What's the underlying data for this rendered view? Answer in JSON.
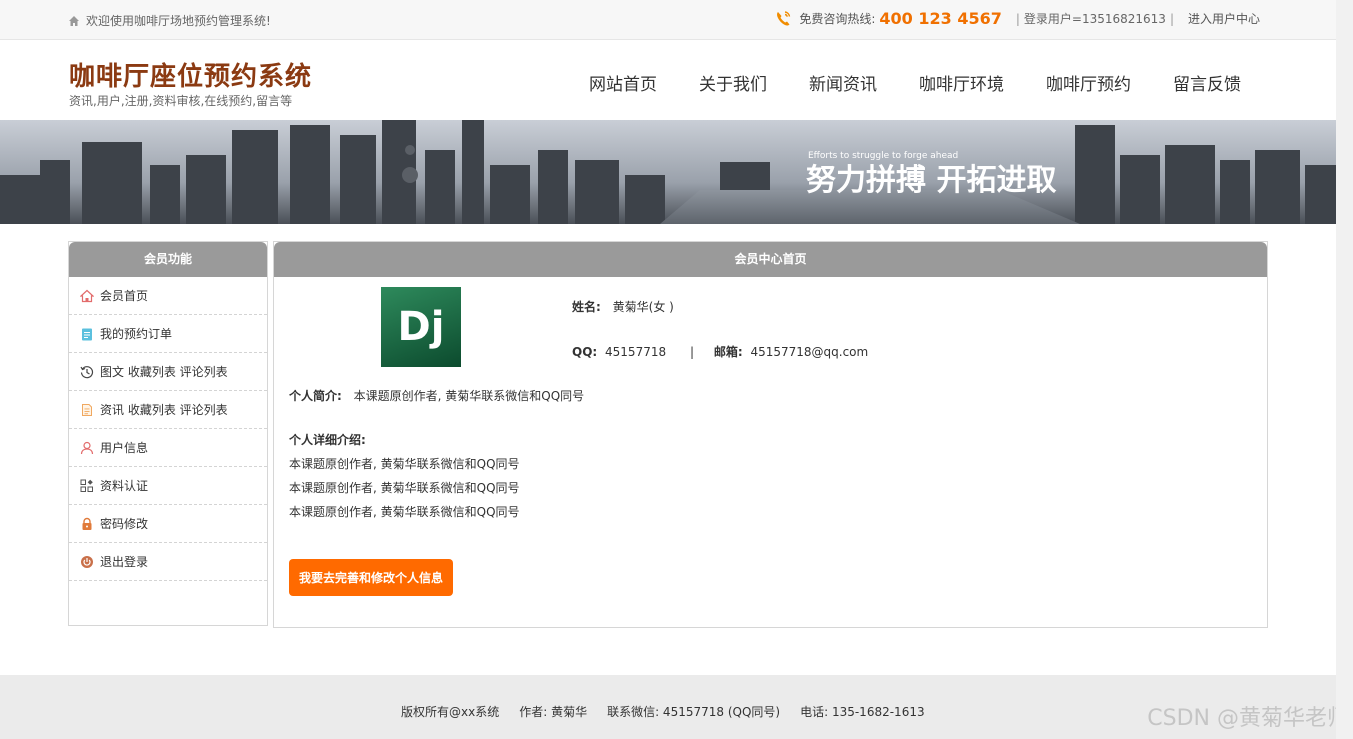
{
  "topbar": {
    "welcome": "欢迎使用咖啡厅场地预约管理系统!",
    "hotline_label": "免费咨询热线:",
    "hotline_number": "400 123 4567",
    "login_user": "登录用户=13516821613",
    "user_center_link": "进入用户中心"
  },
  "header": {
    "title": "咖啡厅座位预约系统",
    "subtitle": "资讯,用户,注册,资料审核,在线预约,留言等"
  },
  "nav": [
    "网站首页",
    "关于我们",
    "新闻资讯",
    "咖啡厅环境",
    "咖啡厅预约",
    "留言反馈"
  ],
  "banner": {
    "small_text": "Efforts to struggle to forge ahead",
    "slogan": "努力拼搏 开拓进取"
  },
  "sidebar": {
    "title": "会员功能",
    "items": [
      {
        "label": "会员首页",
        "icon": "home-icon"
      },
      {
        "label": "我的预约订单",
        "icon": "clipboard-icon"
      },
      {
        "label": "图文 收藏列表 评论列表",
        "icon": "history-icon"
      },
      {
        "label": "资讯 收藏列表 评论列表",
        "icon": "document-icon"
      },
      {
        "label": "用户信息",
        "icon": "user-icon"
      },
      {
        "label": "资料认证",
        "icon": "grid-icon"
      },
      {
        "label": "密码修改",
        "icon": "lock-icon"
      },
      {
        "label": "退出登录",
        "icon": "power-icon"
      }
    ]
  },
  "main": {
    "title": "会员中心首页",
    "avatar_text": "Dj",
    "name_label": "姓名:",
    "name_value": "黄菊华(女 )",
    "qq_label": "QQ:",
    "qq_value": "45157718",
    "divider": "|",
    "email_label": "邮箱:",
    "email_value": "45157718@qq.com",
    "intro_label": "个人简介:",
    "intro_value": "本课题原创作者, 黄菊华联系微信和QQ同号",
    "detail_label": "个人详细介绍:",
    "detail_lines": [
      "本课题原创作者, 黄菊华联系微信和QQ同号",
      "本课题原创作者, 黄菊华联系微信和QQ同号",
      "本课题原创作者, 黄菊华联系微信和QQ同号"
    ],
    "edit_button": "我要去完善和修改个人信息"
  },
  "footer": {
    "copyright": "版权所有@xx系统",
    "author": "作者: 黄菊华",
    "wechat": "联系微信: 45157718 (QQ同号)",
    "phone": "电话: 135-1682-1613"
  },
  "watermark": "CSDN @黄菊华老师",
  "colors": {
    "accent_orange": "#ff6a00",
    "title_brown": "#8b3a12",
    "panel_header_gray": "#9a9a9a"
  }
}
